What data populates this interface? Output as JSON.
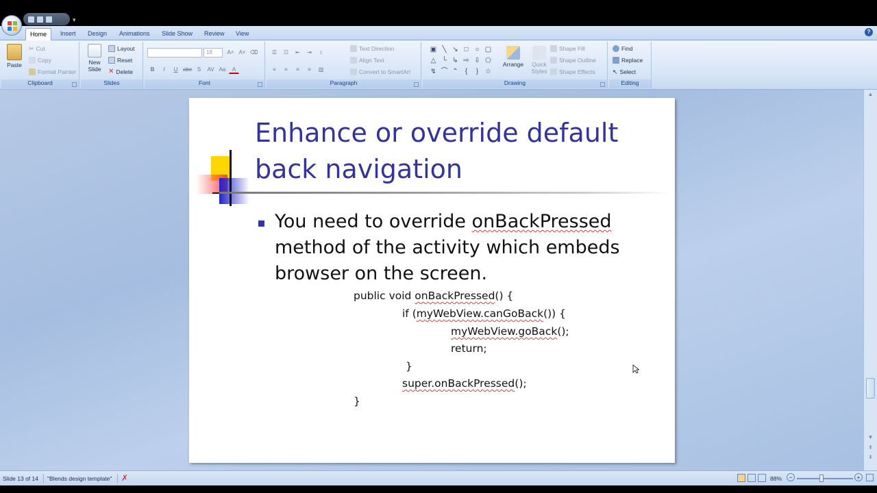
{
  "ribbon_tabs": [
    "Home",
    "Insert",
    "Design",
    "Animations",
    "Slide Show",
    "Review",
    "View"
  ],
  "clipboard": {
    "paste": "Paste",
    "cut": "Cut",
    "copy": "Copy",
    "format_painter": "Format Painter",
    "label": "Clipboard"
  },
  "slides_group": {
    "new_slide": "New Slide",
    "layout": "Layout",
    "reset": "Reset",
    "delete": "Delete",
    "label": "Slides"
  },
  "font_group": {
    "font_size": "18",
    "label": "Font",
    "buttons": [
      "B",
      "I",
      "U",
      "abe",
      "S",
      "AV",
      "Aa",
      "A"
    ]
  },
  "paragraph_group": {
    "text_direction": "Text Direction",
    "align_text": "Align Text",
    "convert_smartart": "Convert to SmartArt",
    "label": "Paragraph"
  },
  "drawing_group": {
    "arrange": "Arrange",
    "quick_styles": "Quick Styles",
    "shape_fill": "Shape Fill",
    "shape_outline": "Shape Outline",
    "shape_effects": "Shape Effects",
    "label": "Drawing"
  },
  "editing_group": {
    "find": "Find",
    "replace": "Replace",
    "select": "Select",
    "label": "Editing"
  },
  "slide": {
    "title": "Enhance or override default back navigation",
    "bullet": {
      "prefix": "You need to override ",
      "method": "onBackPressed",
      "rest": "method of the activity which embeds browser on the screen."
    },
    "code": {
      "line1_a": "public void ",
      "line1_b": "onBackPressed",
      "line1_c": "() {",
      "line2_a": "if (",
      "line2_b": "myWebView.canGoBack",
      "line2_c": "()) {",
      "line3_a": "myWebView.goBack",
      "line3_b": "();",
      "line4": "return;",
      "line5": "}",
      "line6_a": "super.onBackPressed",
      "line6_b": "();",
      "line7": "}"
    }
  },
  "status": {
    "slide_info": "Slide 13 of 14",
    "theme": "\"Blends design template\"",
    "zoom": "88%"
  },
  "colors": {
    "title": "#33339a",
    "bullet": "#3333b3",
    "ribbon": "#d7e5f6",
    "workspace": "#a5bde0"
  }
}
